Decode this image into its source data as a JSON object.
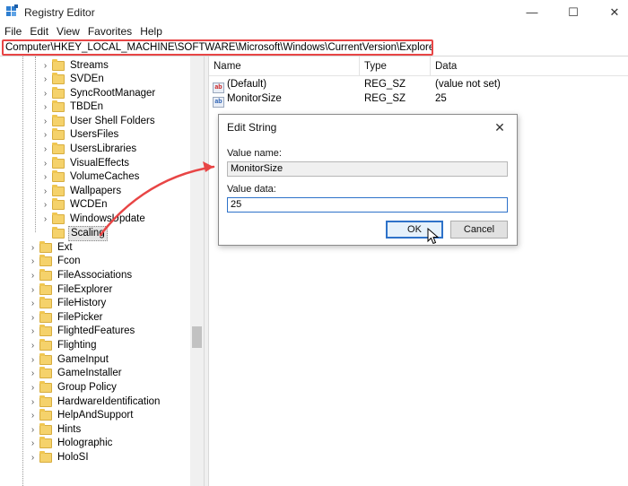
{
  "window": {
    "title": "Registry Editor",
    "minimize_glyph": "—",
    "maximize_glyph": "☐",
    "close_glyph": "✕"
  },
  "menu": [
    "File",
    "Edit",
    "View",
    "Favorites",
    "Help"
  ],
  "address_path": "Computer\\HKEY_LOCAL_MACHINE\\SOFTWARE\\Microsoft\\Windows\\CurrentVersion\\Explorer\\Scaling",
  "tree": {
    "children": [
      "Streams",
      "SVDEn",
      "SyncRootManager",
      "TBDEn",
      "User Shell Folders",
      "UsersFiles",
      "UsersLibraries",
      "VisualEffects",
      "VolumeCaches",
      "Wallpapers",
      "WCDEn",
      "WindowsUpdate",
      "Scaling"
    ],
    "selected": "Scaling",
    "siblings": [
      "Ext",
      "Fcon",
      "FileAssociations",
      "FileExplorer",
      "FileHistory",
      "FilePicker",
      "FlightedFeatures",
      "Flighting",
      "GameInput",
      "GameInstaller",
      "Group Policy",
      "HardwareIdentification",
      "HelpAndSupport",
      "Hints",
      "Holographic",
      "HoloSI"
    ]
  },
  "list": {
    "columns": [
      "Name",
      "Type",
      "Data"
    ],
    "rows": [
      {
        "icon": "string-value-icon",
        "name": "(Default)",
        "type": "REG_SZ",
        "data": "(value not set)"
      },
      {
        "icon": "binary-value-icon",
        "name": "MonitorSize",
        "type": "REG_SZ",
        "data": "25"
      }
    ]
  },
  "dialog": {
    "title": "Edit String",
    "close_glyph": "✕",
    "value_name_label": "Value name:",
    "value_name": "MonitorSize",
    "value_data_label": "Value data:",
    "value_data": "25",
    "ok_label": "OK",
    "cancel_label": "Cancel"
  },
  "colors": {
    "highlight": "#e84545",
    "accent": "#2e72c9"
  }
}
